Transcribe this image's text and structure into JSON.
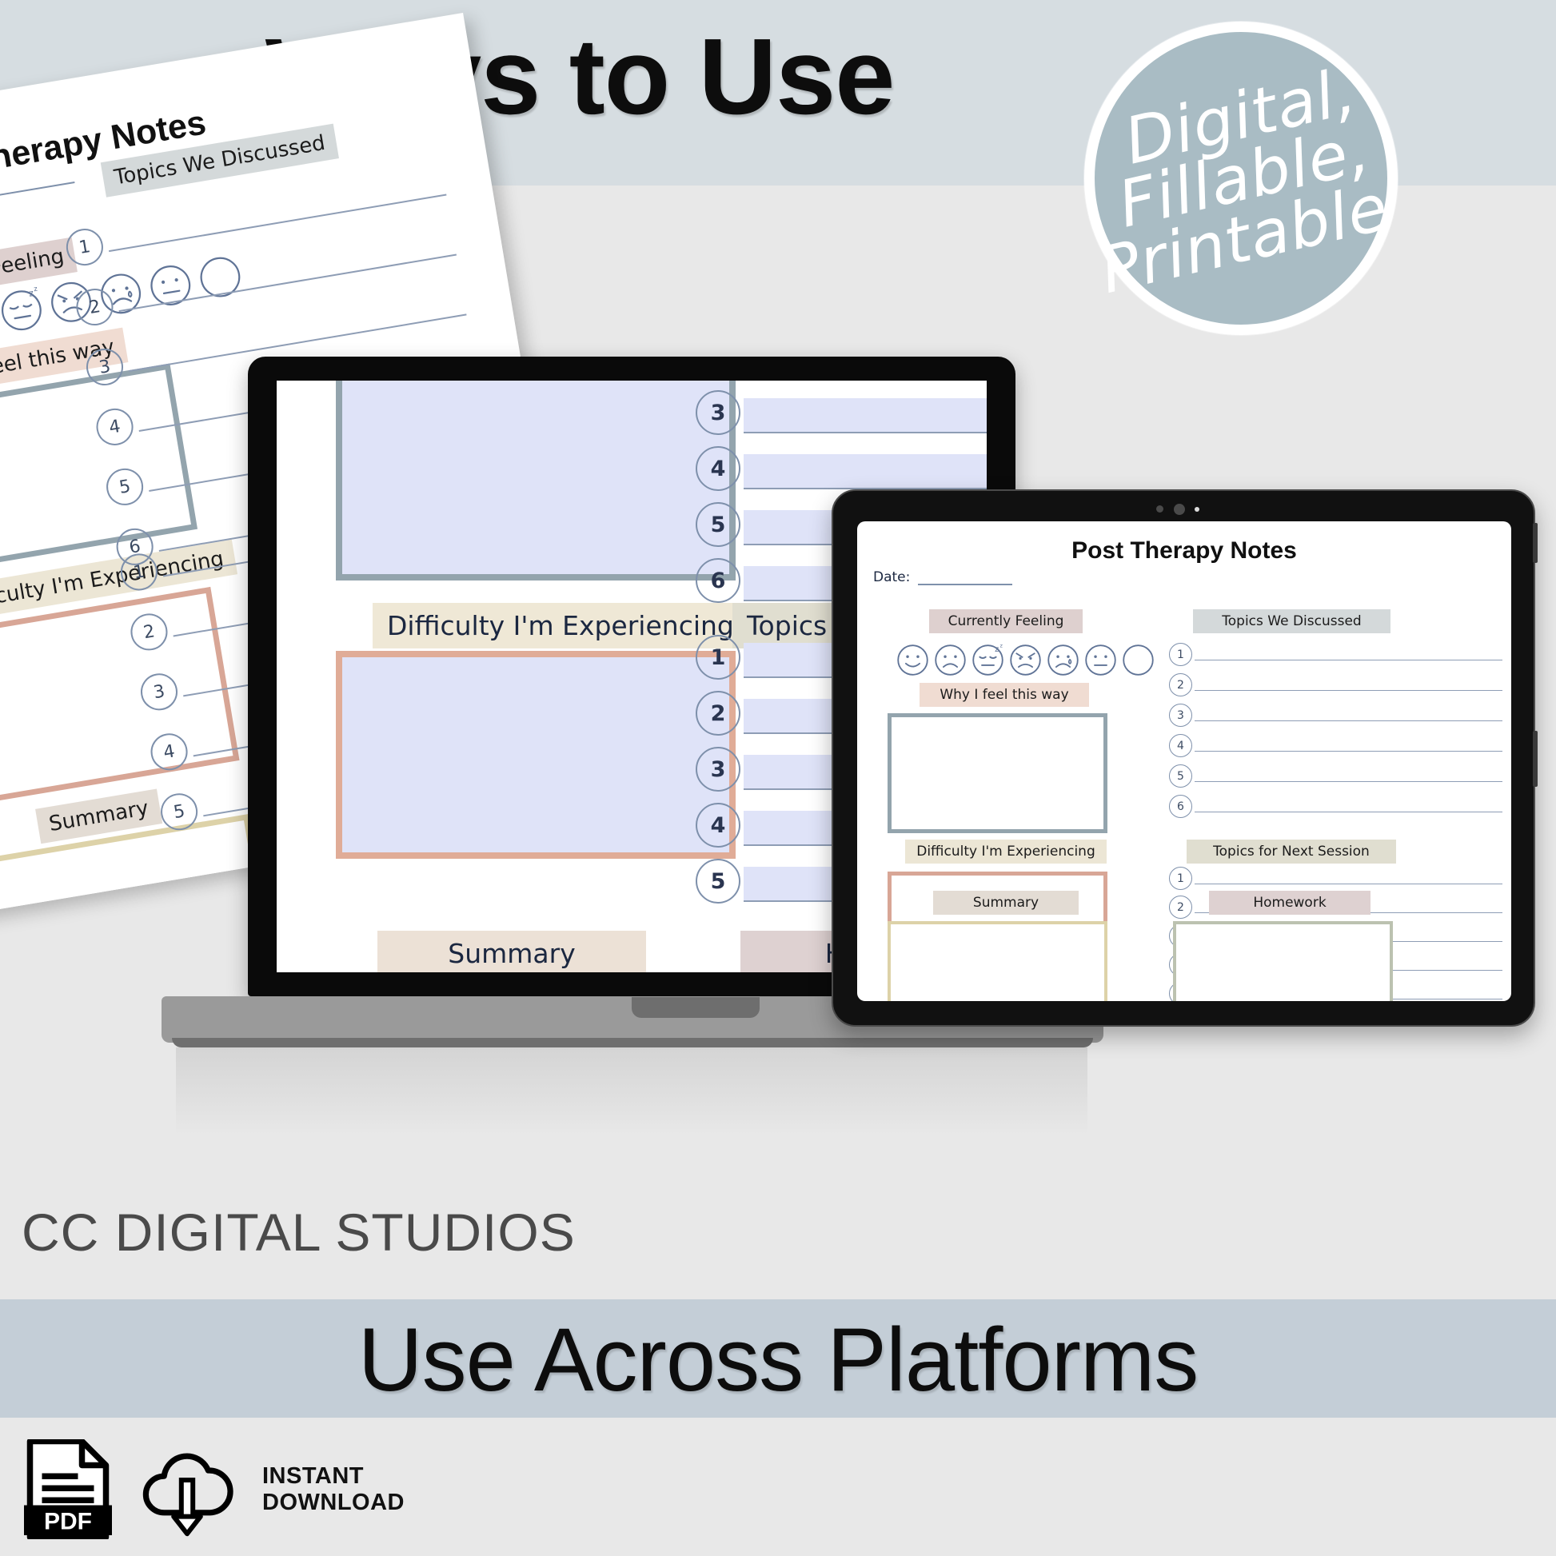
{
  "headline": "Ways to Use",
  "badge": {
    "line1": "Digital,",
    "line2": "Fillable,",
    "line3": "Printable",
    "bg_color": "#a9bcc4",
    "ring_color": "#ffffff"
  },
  "brand": "CC DIGITAL STUDIOS",
  "subheadline": "Use Across Platforms",
  "footer": {
    "pdf_label": "PDF",
    "instant_line1": "INSTANT",
    "instant_line2": "DOWNLOAD",
    "pdf_icon": "pdf-file-icon",
    "download_icon": "cloud-download-icon"
  },
  "colors": {
    "band_top": "#d6dde1",
    "band_mid": "#e8e8e8",
    "band_accent": "#c4ced7",
    "chip_feeling": "#ded0cf",
    "chip_why": "#f0dcd2",
    "chip_topics": "#d4d9da",
    "chip_difficulty": "#ece6d5",
    "chip_next": "#e0ded0",
    "chip_summary": "#e3dcd4",
    "chip_homework": "#ded1d1",
    "box_why": "#93a4ad",
    "box_difficulty": "#d8a696",
    "box_summary": "#ddd2a8",
    "box_homework": "#bcc2b0",
    "field_fill": "#dfe3f8",
    "rule": "#8e9db5"
  },
  "form": {
    "title": "Post Therapy Notes",
    "date_label": "Date:",
    "sections": {
      "currently_feeling": "Currently Feeling",
      "why_i_feel": "Why I feel this way",
      "difficulty": "Difficulty I'm Experiencing",
      "summary": "Summary",
      "topics_discussed": "Topics We Discussed",
      "topics_next": "Topics for Next Session",
      "homework": "Homework"
    },
    "faces": [
      {
        "name": "happy-face-icon",
        "mood": "happy"
      },
      {
        "name": "sad-face-icon",
        "mood": "sad"
      },
      {
        "name": "sleepy-face-icon",
        "mood": "sleepy"
      },
      {
        "name": "angry-face-icon",
        "mood": "angry"
      },
      {
        "name": "crying-face-icon",
        "mood": "crying"
      },
      {
        "name": "neutral-face-icon",
        "mood": "neutral"
      },
      {
        "name": "blank-face-icon",
        "mood": "blank"
      }
    ],
    "topics_discussed_numbers": [
      "1",
      "2",
      "3",
      "4",
      "5",
      "6"
    ],
    "topics_next_numbers": [
      "1",
      "2",
      "3",
      "4",
      "5"
    ]
  },
  "laptop": {
    "visible_labels": {
      "difficulty": "Difficulty I'm Experiencing",
      "topics_next_partial": "Topics for Nex",
      "summary_partial": "Summary",
      "homework_partial": "Homew"
    },
    "topics_discussed_visible": [
      "3",
      "4",
      "5",
      "6"
    ],
    "topics_next_visible": [
      "1",
      "2",
      "3",
      "4",
      "5"
    ]
  },
  "paper": {
    "title": "Post Therapy Notes",
    "chips": {
      "currently_feeling": "urrently Feeling",
      "why_i_feel": "Why I feel this way",
      "topics_discussed": "Topics We Discussed",
      "difficulty": "Difficulty I'm Experiencing",
      "summary": "Summary"
    },
    "topics_numbers": [
      "1",
      "2",
      "3",
      "4",
      "5",
      "6"
    ],
    "next_numbers": [
      "1",
      "2",
      "3",
      "4",
      "5"
    ]
  }
}
